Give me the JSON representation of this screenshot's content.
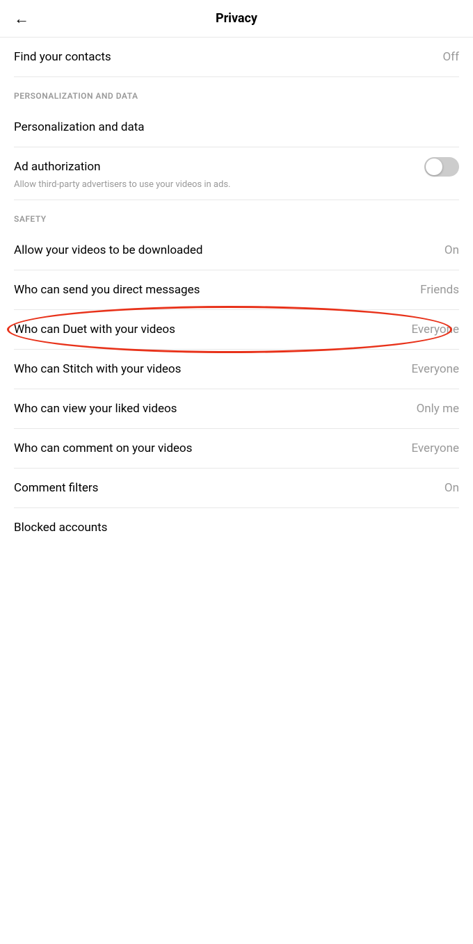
{
  "header": {
    "title": "Privacy",
    "back_icon": "←"
  },
  "settings": {
    "find_contacts": {
      "label": "Find your contacts",
      "value": "Off"
    },
    "sections": [
      {
        "id": "personalization",
        "label": "PERSONALIZATION AND DATA",
        "items": [
          {
            "id": "personalization_data",
            "label": "Personalization and data",
            "value": null,
            "toggle": null
          },
          {
            "id": "ad_authorization",
            "label": "Ad authorization",
            "sublabel": "Allow third-party advertisers to use your videos in ads.",
            "value": null,
            "toggle": "off"
          }
        ]
      },
      {
        "id": "safety",
        "label": "SAFETY",
        "items": [
          {
            "id": "allow_downloads",
            "label": "Allow your videos to be downloaded",
            "value": "On",
            "toggle": null,
            "highlighted": false
          },
          {
            "id": "direct_messages",
            "label": "Who can send you direct messages",
            "value": "Friends",
            "toggle": null,
            "highlighted": false
          },
          {
            "id": "duet",
            "label": "Who can Duet with your videos",
            "value": "Everyone",
            "toggle": null,
            "highlighted": true
          },
          {
            "id": "stitch",
            "label": "Who can Stitch with your videos",
            "value": "Everyone",
            "toggle": null,
            "highlighted": false
          },
          {
            "id": "liked_videos",
            "label": "Who can view your liked videos",
            "value": "Only me",
            "toggle": null,
            "highlighted": false
          },
          {
            "id": "comment_videos",
            "label": "Who can comment on your videos",
            "value": "Everyone",
            "toggle": null,
            "highlighted": false
          },
          {
            "id": "comment_filters",
            "label": "Comment filters",
            "value": "On",
            "toggle": null,
            "highlighted": false
          },
          {
            "id": "blocked_accounts",
            "label": "Blocked accounts",
            "value": null,
            "toggle": null,
            "highlighted": false
          }
        ]
      }
    ]
  }
}
